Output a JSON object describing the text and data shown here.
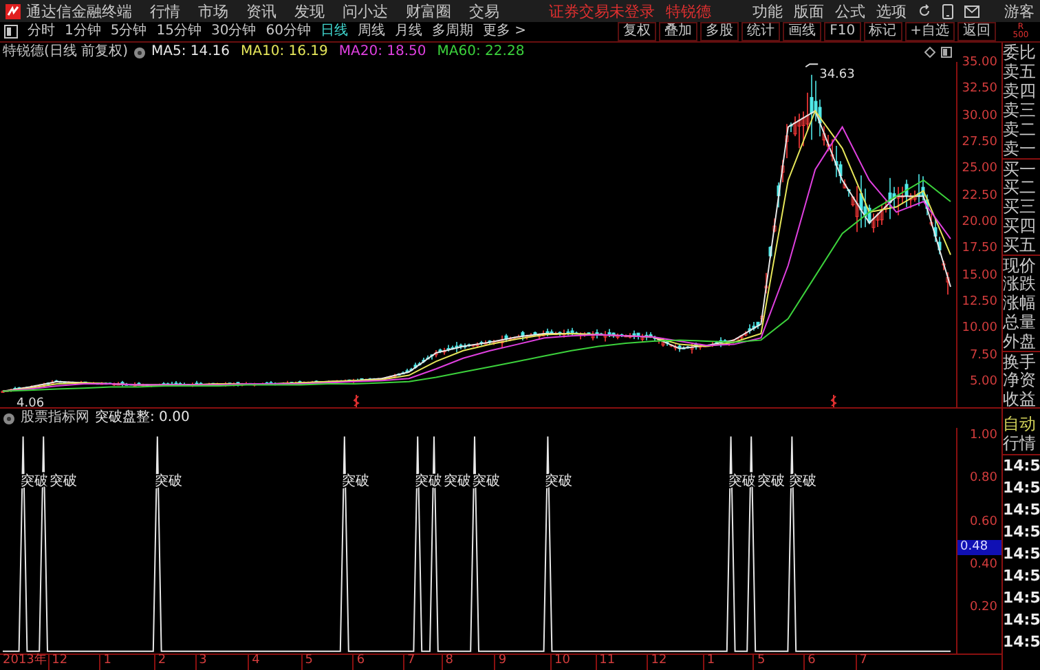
{
  "app_bar": {
    "title": "通达信金融终端",
    "menu": [
      "行情",
      "市场",
      "资讯",
      "发现",
      "问小达",
      "财富圈",
      "交易"
    ],
    "login_status": "证券交易未登录",
    "stock_name": "特锐德",
    "right_menu": [
      "功能",
      "版面",
      "公式",
      "选项"
    ],
    "user": "游客"
  },
  "period_tabs": [
    {
      "label": "分时",
      "selected": false
    },
    {
      "label": "1分钟",
      "selected": false
    },
    {
      "label": "5分钟",
      "selected": false
    },
    {
      "label": "15分钟",
      "selected": false
    },
    {
      "label": "30分钟",
      "selected": false
    },
    {
      "label": "60分钟",
      "selected": false
    },
    {
      "label": "日线",
      "selected": true
    },
    {
      "label": "周线",
      "selected": false
    },
    {
      "label": "月线",
      "selected": false
    },
    {
      "label": "多周期",
      "selected": false
    },
    {
      "label": "更多 >",
      "selected": false
    }
  ],
  "tool_buttons": [
    "复权",
    "叠加",
    "多股",
    "统计",
    "画线",
    "F10",
    "标记",
    "+自选",
    "返回"
  ],
  "corner_mark": [
    "R",
    "500"
  ],
  "price_chart": {
    "title": "特锐德(日线 前复权)",
    "ma_values": [
      ": 14.16",
      ": 16.19",
      ": 18.50",
      ": 22.28"
    ],
    "chart_data": {
      "type": "line",
      "ylim": [
        2.7,
        35.1
      ],
      "yticks": [
        {
          "value": 35,
          "label": "35.00"
        },
        {
          "value": 32.5,
          "label": "32.50"
        },
        {
          "value": 30,
          "label": "30.00"
        },
        {
          "value": 27.5,
          "label": "27.50"
        },
        {
          "value": 25,
          "label": "25.00"
        },
        {
          "value": 22.5,
          "label": "22.50"
        },
        {
          "value": 20,
          "label": "20.00"
        },
        {
          "value": 17.5,
          "label": "17.50"
        },
        {
          "value": 15,
          "label": "15.00"
        },
        {
          "value": 12.5,
          "label": "12.50"
        },
        {
          "value": 10,
          "label": "10.00"
        },
        {
          "value": 7.5,
          "label": "7.50"
        },
        {
          "value": 5,
          "label": "5.00"
        }
      ],
      "series": [
        {
          "name": "MA5",
          "color": "#e8e8e8",
          "values": [
            4.2,
            4.6,
            5.1,
            5.0,
            4.9,
            4.8,
            4.8,
            4.8,
            4.9,
            4.9,
            4.9,
            5.0,
            5.1,
            5.2,
            5.4,
            6.0,
            7.8,
            8.4,
            8.8,
            9.3,
            9.6,
            9.6,
            9.5,
            9.4,
            9.3,
            8.2,
            8.5,
            9.0,
            10.5,
            29,
            30.5,
            24,
            20,
            22.5,
            22.5,
            14
          ]
        },
        {
          "name": "MA10",
          "color": "#e6e65a",
          "values": [
            4.2,
            4.5,
            4.9,
            5.0,
            4.9,
            4.8,
            4.8,
            4.8,
            4.9,
            4.9,
            4.9,
            5.0,
            5.1,
            5.2,
            5.3,
            5.7,
            7.0,
            8.0,
            8.6,
            9.1,
            9.5,
            9.6,
            9.5,
            9.4,
            9.3,
            8.6,
            8.4,
            8.8,
            9.6,
            24,
            30.5,
            27,
            21,
            21.5,
            23,
            17
          ]
        },
        {
          "name": "MA20",
          "color": "#e040e0",
          "values": [
            4.2,
            4.4,
            4.7,
            4.9,
            4.9,
            4.8,
            4.8,
            4.8,
            4.8,
            4.9,
            4.9,
            4.9,
            5.0,
            5.1,
            5.2,
            5.4,
            6.3,
            7.3,
            8.0,
            8.6,
            9.2,
            9.4,
            9.5,
            9.4,
            9.3,
            8.9,
            8.5,
            8.6,
            9.2,
            16,
            25,
            29,
            24,
            21,
            22,
            18.5
          ]
        },
        {
          "name": "MA60",
          "color": "#3cd23c",
          "values": [
            4.2,
            4.3,
            4.4,
            4.5,
            4.6,
            4.6,
            4.7,
            4.7,
            4.7,
            4.8,
            4.8,
            4.8,
            4.9,
            4.9,
            5.0,
            5.1,
            5.5,
            6.0,
            6.5,
            7.0,
            7.5,
            8.0,
            8.4,
            8.7,
            8.9,
            9.0,
            8.9,
            8.8,
            9.0,
            11,
            15,
            19,
            21,
            22.5,
            24,
            22
          ]
        }
      ]
    },
    "high_label": "34.63",
    "low_label": "4.06"
  },
  "indicator": {
    "source": "股票指标网",
    "legend_value": ": 0.00",
    "chart_data": {
      "type": "line",
      "ylim": [
        -0.01,
        1.04
      ],
      "yticks": [
        {
          "value": 1,
          "label": "1.00"
        },
        {
          "value": 0.8,
          "label": "0.80"
        },
        {
          "value": 0.6,
          "label": "0.60"
        },
        {
          "value": 0.4,
          "label": "0.40"
        },
        {
          "value": 0.2,
          "label": "0.20"
        }
      ],
      "series": [
        {
          "name": "突破盘整",
          "color": "#e8e8e8",
          "values": [
            0,
            0,
            0,
            0,
            0,
            1,
            0,
            0,
            0,
            0,
            1,
            0,
            0,
            0,
            0,
            0,
            0,
            0,
            0,
            0,
            0,
            0,
            0,
            0,
            0,
            0,
            0,
            0,
            0,
            0,
            0,
            0,
            0,
            0,
            0,
            0,
            0,
            0,
            1,
            0,
            0,
            0,
            0,
            0,
            0,
            0,
            0,
            0,
            0,
            0,
            0,
            0,
            0,
            0,
            0,
            0,
            0,
            0,
            0,
            0,
            0,
            0,
            0,
            0,
            0,
            0,
            0,
            0,
            0,
            0,
            0,
            0,
            0,
            0,
            0,
            0,
            0,
            0,
            0,
            0,
            0,
            0,
            0,
            0,
            1,
            0,
            0,
            0,
            0,
            0,
            0,
            0,
            0,
            0,
            0,
            0,
            0,
            0,
            0,
            0,
            0,
            0,
            1,
            0,
            0,
            0,
            1,
            0,
            0,
            0,
            0,
            0,
            0,
            0,
            0,
            0,
            1,
            0,
            0,
            0,
            0,
            0,
            0,
            0,
            0,
            0,
            0,
            0,
            0,
            0,
            0,
            0,
            0,
            0,
            1,
            0,
            0,
            0,
            0,
            0,
            0,
            0,
            0,
            0,
            0,
            0,
            0,
            0,
            0,
            0,
            0,
            0,
            0,
            0,
            0,
            0,
            0,
            0,
            0,
            0,
            0,
            0,
            0,
            0,
            0,
            0,
            0,
            0,
            0,
            0,
            0,
            0,
            0,
            0,
            0,
            0,
            0,
            0,
            0,
            1,
            0,
            0,
            0,
            0,
            1,
            0,
            0,
            0,
            0,
            0,
            0,
            0,
            0,
            0,
            1,
            0,
            0,
            0,
            0,
            0,
            0,
            0,
            0,
            0,
            0,
            0,
            0,
            0,
            0,
            0,
            0,
            0,
            0,
            0,
            0,
            0,
            0,
            0,
            0,
            0,
            0,
            0,
            0,
            0,
            0,
            0,
            0,
            0,
            0,
            0,
            0,
            0,
            0,
            0
          ]
        }
      ]
    },
    "signal_labels": [
      "突破",
      "突破",
      "突破",
      "突破",
      "突破",
      "突破",
      "突破",
      "突破",
      "突破",
      "突破",
      "突破"
    ],
    "cursor_value": "0.48"
  },
  "time_axis": [
    "2013年",
    "12",
    "1",
    "2",
    "3",
    "4",
    "5",
    "6",
    "7",
    "8",
    "9",
    "10",
    "11",
    "12",
    "1",
    "5",
    "6",
    "7"
  ],
  "quote_panel": {
    "labels": [
      "委比",
      "卖五",
      "卖四",
      "卖三",
      "卖二",
      "卖一",
      "买一",
      "买二",
      "买三",
      "买四",
      "买五",
      "现价",
      "涨跌",
      "涨幅",
      "总量",
      "外盘",
      "换手",
      "净资",
      "收益"
    ],
    "mode": "自动",
    "tab": "行情",
    "times": [
      "14:5",
      "14:5",
      "14:5",
      "14:5",
      "14:5",
      "14:5",
      "14:5",
      "14:5",
      "14:5"
    ]
  }
}
